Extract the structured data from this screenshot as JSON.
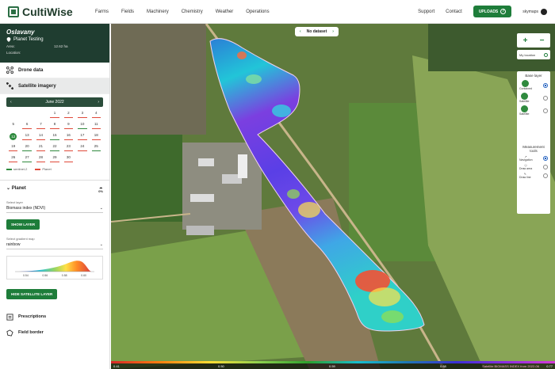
{
  "app": {
    "name": "CultiWise"
  },
  "nav": [
    "Farms",
    "Fields",
    "Machinery",
    "Chemistry",
    "Weather",
    "Operations"
  ],
  "topright": {
    "support": "Support",
    "contact": "Contact",
    "uploads": "UPLOADS",
    "user": "skymaps"
  },
  "farm": {
    "name": "Oslavany",
    "subtitle": "Planet Testing",
    "area_label": "Area:",
    "area_value": "12.62 ha",
    "location_label": "Location:"
  },
  "sidebar": {
    "drone": "Drone data",
    "satellite": "Satellite imagery",
    "prescriptions": "Prescriptions",
    "field_border": "Field border"
  },
  "calendar": {
    "month": "June 2022",
    "legend_s2": "sentinel-2",
    "legend_planet": "Planet",
    "cells": [
      {
        "d": ""
      },
      {
        "d": ""
      },
      {
        "d": ""
      },
      {
        "d": "1",
        "c": "#e04a3a"
      },
      {
        "d": "2",
        "c": "#e04a3a"
      },
      {
        "d": "3",
        "c": "#e04a3a"
      },
      {
        "d": "4",
        "c": "#e04a3a"
      },
      {
        "d": "5"
      },
      {
        "d": "6",
        "c": "#e04a3a"
      },
      {
        "d": "7",
        "c": "#e04a3a"
      },
      {
        "d": "8",
        "c": "#e04a3a"
      },
      {
        "d": "9",
        "c": "#e04a3a"
      },
      {
        "d": "10",
        "c": "#2f8a3e"
      },
      {
        "d": "11",
        "c": "#e04a3a"
      },
      {
        "d": "12",
        "sel": true
      },
      {
        "d": "13",
        "c": "#e04a3a"
      },
      {
        "d": "14",
        "c": "#e04a3a"
      },
      {
        "d": "15",
        "c": "#2f8a3e"
      },
      {
        "d": "16",
        "c": "#e04a3a"
      },
      {
        "d": "17",
        "c": "#e04a3a"
      },
      {
        "d": "18",
        "c": "#e04a3a"
      },
      {
        "d": "19",
        "c": "#e04a3a"
      },
      {
        "d": "20",
        "c": "#2f8a3e"
      },
      {
        "d": "21",
        "c": "#e04a3a"
      },
      {
        "d": "22",
        "c": "#2f8a3e"
      },
      {
        "d": "23",
        "c": "#e04a3a"
      },
      {
        "d": "24",
        "c": "#e04a3a"
      },
      {
        "d": "25",
        "c": "#2f8a3e"
      },
      {
        "d": "26",
        "c": "#e04a3a"
      },
      {
        "d": "27",
        "c": "#2f8a3e"
      },
      {
        "d": "28",
        "c": "#e04a3a"
      },
      {
        "d": "29",
        "c": "#e04a3a"
      },
      {
        "d": "30",
        "c": "#e04a3a"
      },
      {
        "d": ""
      },
      {
        "d": ""
      }
    ]
  },
  "planet": {
    "title": "Planet",
    "cloud": "0%",
    "select_layer_label": "Select layer",
    "layer_value": "Biomass index (NDVI)",
    "show_layer": "SHOW LAYER",
    "gradient_label": "Select gradient map",
    "gradient_value": "rainbow",
    "ticks": [
      "0.54",
      "0.56",
      "0.58",
      "0.60"
    ],
    "hide_layer": "HIDE SATELLITE LAYER"
  },
  "map": {
    "dataset": "No dataset",
    "my_location": "My location",
    "base_layer": "Base layer",
    "base_options": [
      "Contained",
      "Satellite",
      "Satellite"
    ],
    "measurement": "Measurement tools",
    "measure_options": [
      "Navigation",
      "Draw area",
      "Draw line"
    ],
    "scale_labels": [
      "0.41",
      "0.50",
      "0.59",
      "0.68",
      "0.77"
    ],
    "scale_title": "Satellite BIOMASS INDEX from 2022-06"
  },
  "colors": {
    "brand_green": "#1e7d3a",
    "panel_dark": "#1f3d30"
  }
}
